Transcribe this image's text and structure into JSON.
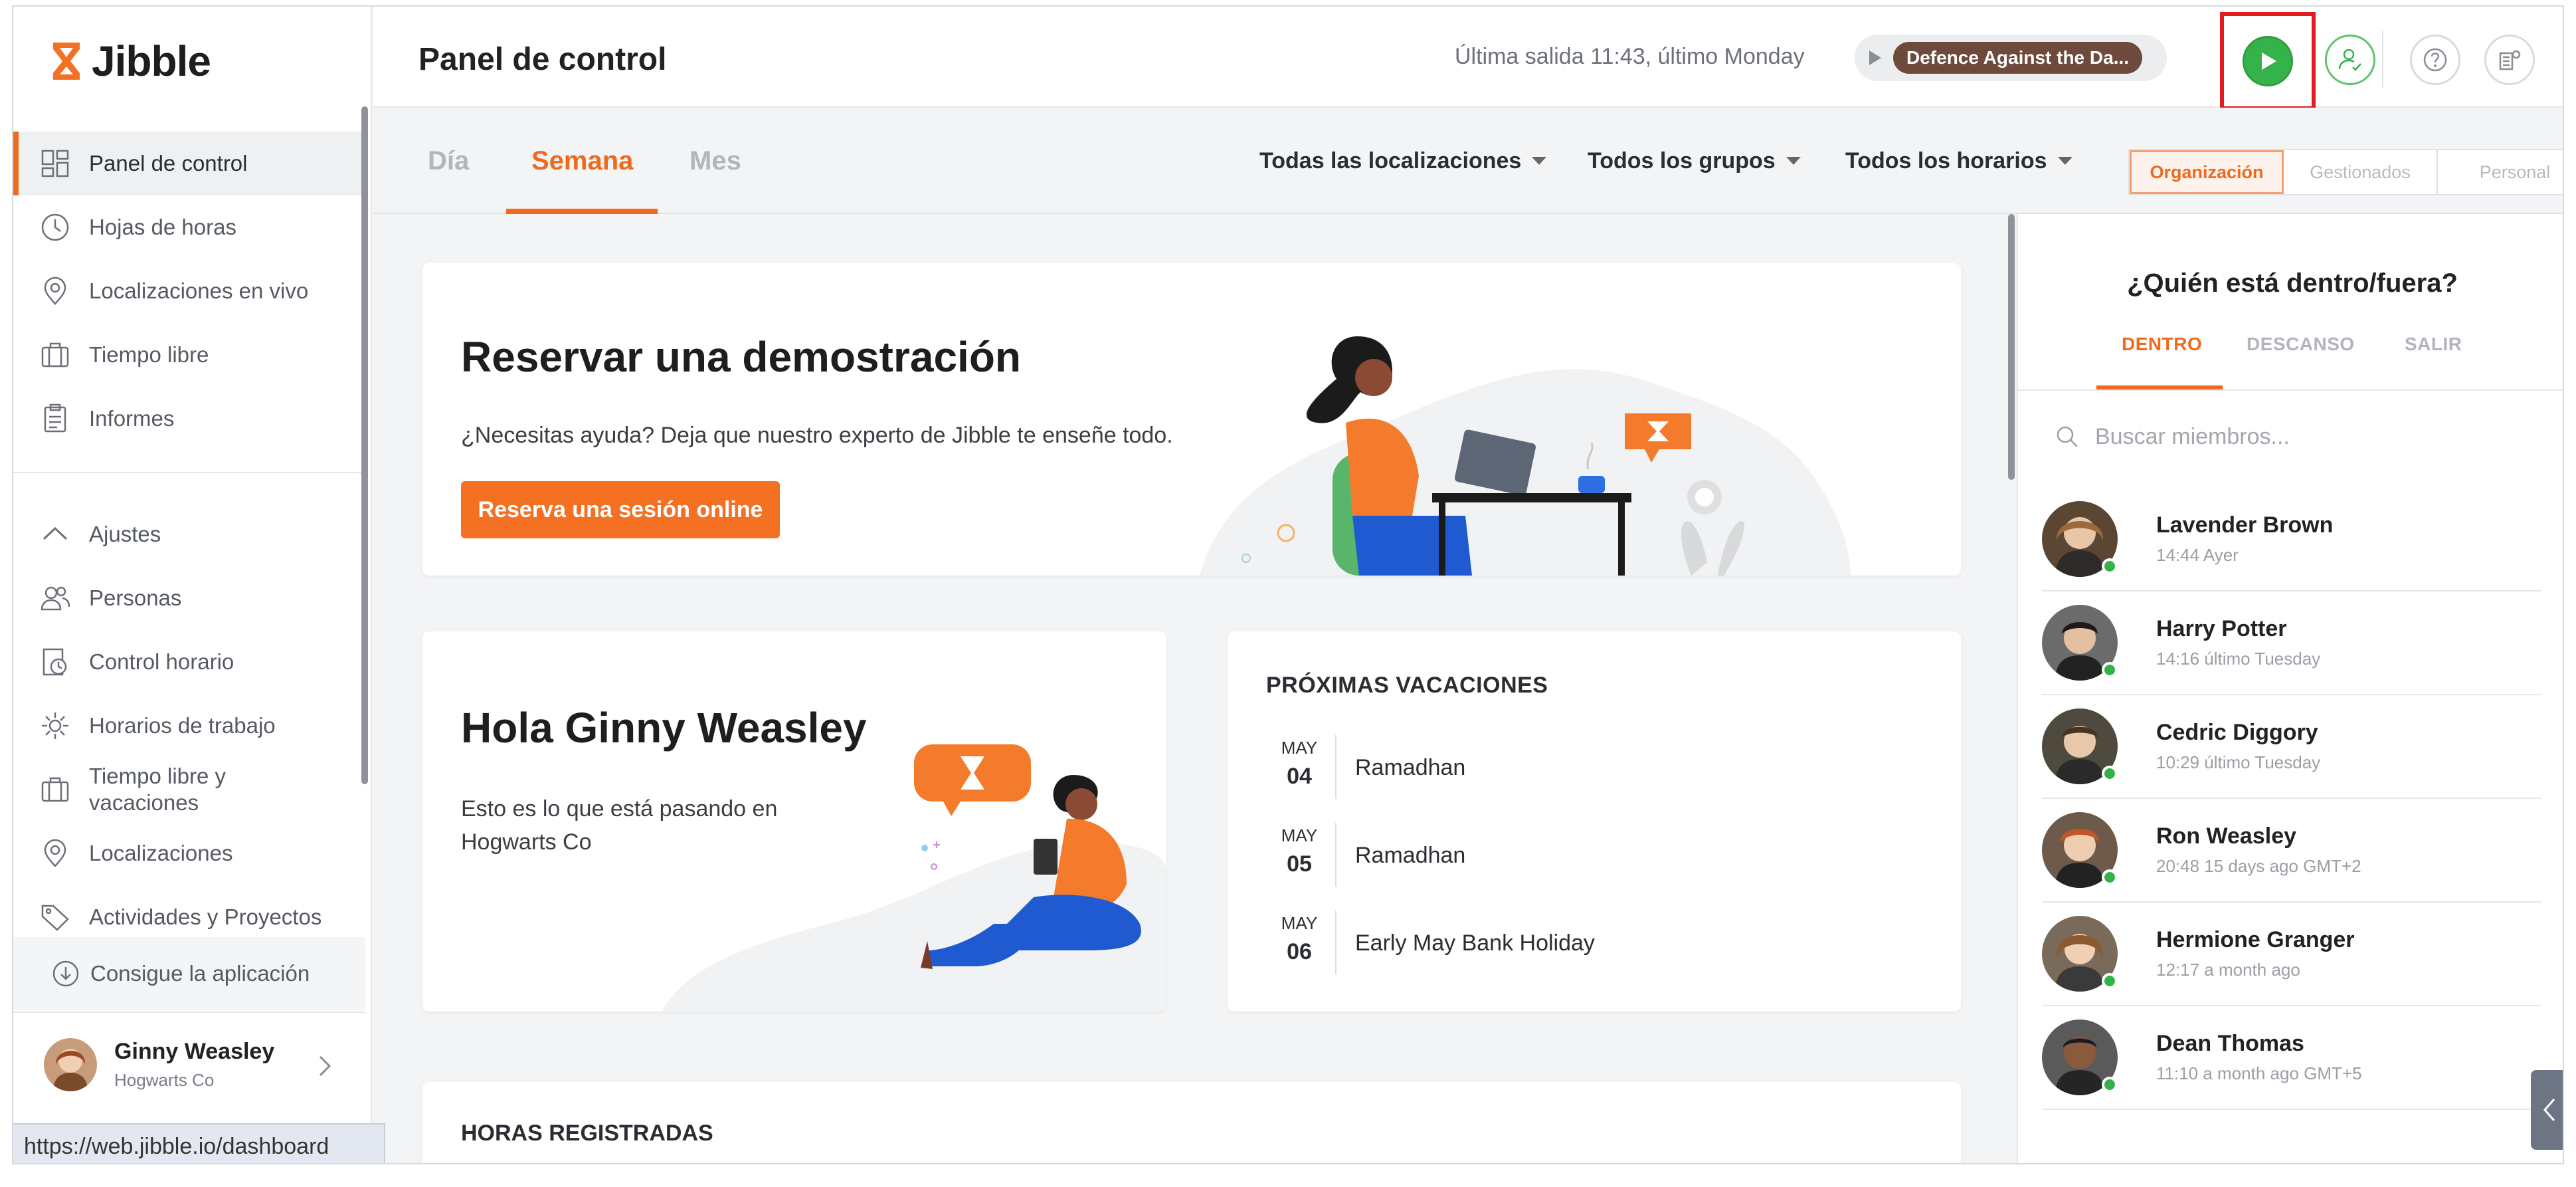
{
  "brand": {
    "name": "Jibble",
    "accent": "#f06a1d"
  },
  "sidebar": {
    "items": [
      {
        "label": "Panel de control",
        "icon": "dashboard-icon",
        "active": true
      },
      {
        "label": "Hojas de horas",
        "icon": "clock-icon"
      },
      {
        "label": "Localizaciones en vivo",
        "icon": "location-pin-icon"
      },
      {
        "label": "Tiempo libre",
        "icon": "suitcase-icon"
      },
      {
        "label": "Informes",
        "icon": "clipboard-icon"
      },
      {
        "label": "Ajustes",
        "icon": "chevron-up-icon"
      },
      {
        "label": "Personas",
        "icon": "people-icon"
      },
      {
        "label": "Control horario",
        "icon": "time-tracking-icon"
      },
      {
        "label": "Horarios de trabajo",
        "icon": "gear-schedule-icon"
      },
      {
        "label": "Tiempo libre y vacaciones",
        "icon": "suitcase-icon"
      },
      {
        "label": "Localizaciones",
        "icon": "location-pin-icon"
      },
      {
        "label": "Actividades y Proyectos",
        "icon": "tag-icon"
      }
    ],
    "get_app": "Consigue la aplicación",
    "profile": {
      "name": "Ginny Weasley",
      "org": "Hogwarts Co"
    },
    "status_url": "https://web.jibble.io/dashboard"
  },
  "header": {
    "title": "Panel de control",
    "last_out": "Última salida 11:43, último Monday",
    "project": "Defence Against the Da..."
  },
  "subbar": {
    "tabs": [
      "Día",
      "Semana",
      "Mes"
    ],
    "filters": [
      "Todas las localizaciones",
      "Todos los grupos",
      "Todos los horarios"
    ],
    "segments": [
      "Organización",
      "Gestionados",
      "Personal"
    ]
  },
  "demo": {
    "title": "Reservar una demostración",
    "subtitle": "¿Necesitas ayuda? Deja que nuestro experto de Jibble te enseñe todo.",
    "button": "Reserva una sesión online"
  },
  "hello": {
    "title": "Hola Ginny Weasley",
    "subtitle": "Esto es lo que está pasando en Hogwarts Co"
  },
  "vacations": {
    "heading": "PRÓXIMAS VACACIONES",
    "items": [
      {
        "month": "MAY",
        "day": "04",
        "name": "Ramadhan"
      },
      {
        "month": "MAY",
        "day": "05",
        "name": "Ramadhan"
      },
      {
        "month": "MAY",
        "day": "06",
        "name": "Early May Bank Holiday"
      }
    ]
  },
  "hours": {
    "heading": "HORAS REGISTRADAS"
  },
  "who": {
    "title": "¿Quién está dentro/fuera?",
    "tabs": [
      "DENTRO",
      "DESCANSO",
      "SALIR"
    ],
    "search_placeholder": "Buscar miembros...",
    "members": [
      {
        "name": "Lavender Brown",
        "time": "14:44 Ayer"
      },
      {
        "name": "Harry Potter",
        "time": "14:16 último Tuesday"
      },
      {
        "name": "Cedric Diggory",
        "time": "10:29 último Tuesday"
      },
      {
        "name": "Ron Weasley",
        "time": "20:48 15 days ago GMT+2"
      },
      {
        "name": "Hermione Granger",
        "time": "12:17 a month ago"
      },
      {
        "name": "Dean Thomas",
        "time": "11:10 a month ago GMT+5"
      }
    ]
  }
}
